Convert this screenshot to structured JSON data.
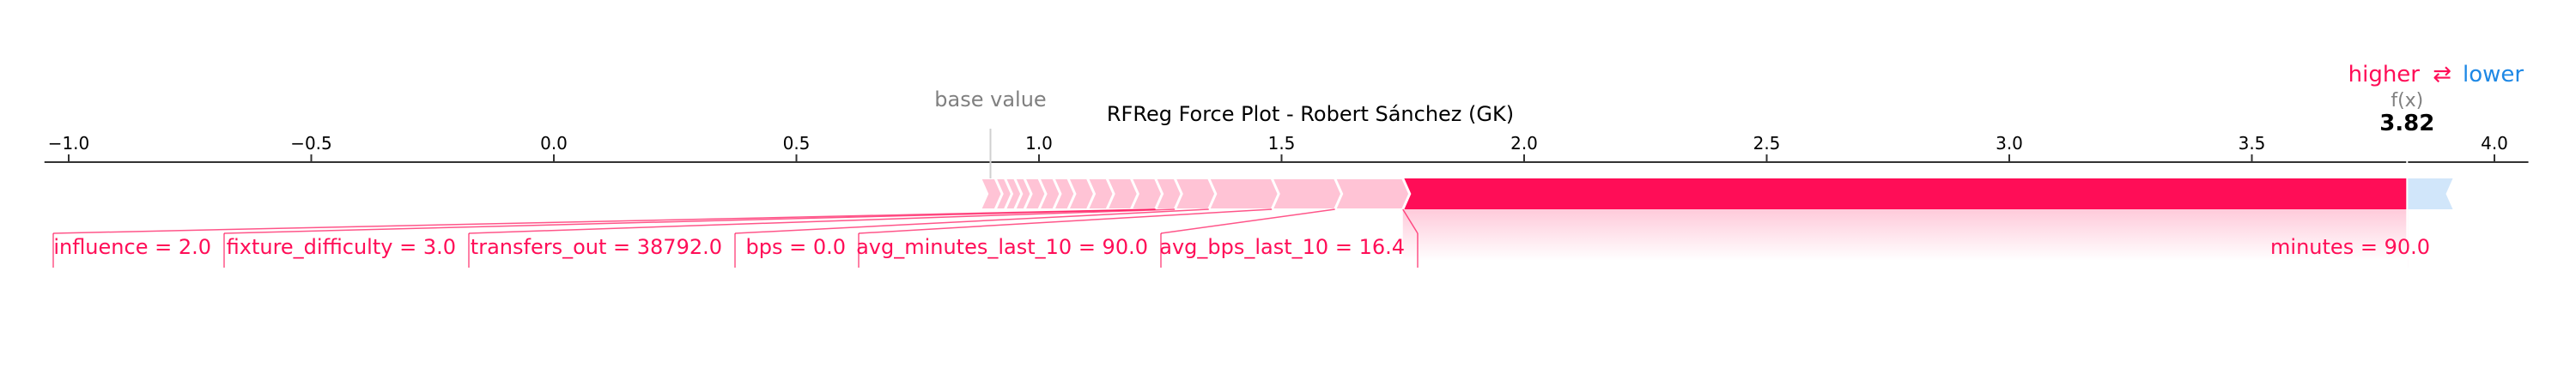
{
  "chart_data": {
    "type": "force",
    "title": "RFReg Force Plot - Robert Sánchez (GK)",
    "legend": {
      "higher": "higher",
      "arrows": "⇄",
      "lower": "lower",
      "placement": "top-right"
    },
    "base_value_label": "base value",
    "base_value": 0.9,
    "fx_label": "f(x)",
    "fx_value": 3.82,
    "fx_text": "3.82",
    "xlim": [
      -1.05,
      4.07
    ],
    "ticks": [
      {
        "value": -1.0,
        "label": "−1.0"
      },
      {
        "value": -0.5,
        "label": "−0.5"
      },
      {
        "value": 0.0,
        "label": "0.0"
      },
      {
        "value": 0.5,
        "label": "0.5"
      },
      {
        "value": 1.0,
        "label": "1.0"
      },
      {
        "value": 1.5,
        "label": "1.5"
      },
      {
        "value": 2.0,
        "label": "2.0"
      },
      {
        "value": 2.5,
        "label": "2.5"
      },
      {
        "value": 3.0,
        "label": "3.0"
      },
      {
        "value": 3.5,
        "label": "3.5"
      },
      {
        "value": 4.0,
        "label": "4.0"
      }
    ],
    "positive_segments": [
      {
        "start": 1.75,
        "end": 3.82
      },
      {
        "start": 1.61,
        "end": 1.75
      },
      {
        "start": 1.48,
        "end": 1.61
      },
      {
        "start": 1.35,
        "end": 1.48
      },
      {
        "start": 1.28,
        "end": 1.35
      },
      {
        "start": 1.24,
        "end": 1.28
      },
      {
        "start": 1.19,
        "end": 1.24
      },
      {
        "start": 1.14,
        "end": 1.19
      },
      {
        "start": 1.1,
        "end": 1.14
      },
      {
        "start": 1.06,
        "end": 1.1
      },
      {
        "start": 1.03,
        "end": 1.06
      },
      {
        "start": 1.0,
        "end": 1.03
      },
      {
        "start": 0.97,
        "end": 1.0
      },
      {
        "start": 0.95,
        "end": 0.97
      },
      {
        "start": 0.93,
        "end": 0.95
      },
      {
        "start": 0.91,
        "end": 0.93
      },
      {
        "start": 0.88,
        "end": 0.91
      }
    ],
    "negative_segment": {
      "start": 3.82,
      "end": 3.9
    },
    "feature_labels": [
      {
        "text": "minutes = 90.0",
        "value": 3.82
      },
      {
        "text": "avg_bps_last_10 = 16.4",
        "value": 1.75
      },
      {
        "text": "avg_minutes_last_10 = 90.0",
        "value": 1.61
      },
      {
        "text": "bps = 0.0",
        "value": 1.48
      },
      {
        "text": "transfers_out = 38792.0",
        "value": 1.35
      },
      {
        "text": "fixture_difficulty = 3.0",
        "value": 1.28
      },
      {
        "text": "influence = 2.0",
        "value": 1.24
      }
    ],
    "colors": {
      "positive": "#ff0d57",
      "negative": "#1e88e5",
      "positive_light": "#ffc3d5",
      "negative_light": "#d1e6fa",
      "text_gray": "#808080"
    }
  }
}
